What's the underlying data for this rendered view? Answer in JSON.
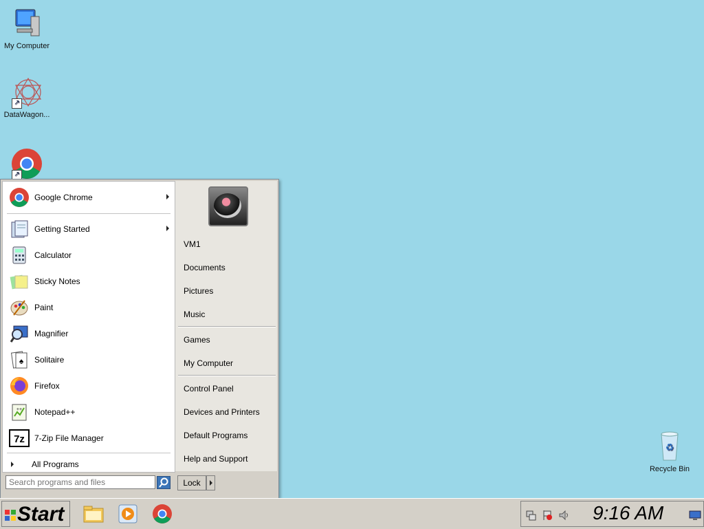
{
  "desktop": {
    "icons": [
      {
        "label": "My Computer"
      },
      {
        "label": "DataWagon..."
      },
      {
        "label": ""
      },
      {
        "label": "Recycle Bin"
      }
    ]
  },
  "start_menu": {
    "pinned": [
      {
        "label": "Google Chrome"
      }
    ],
    "programs": [
      {
        "label": "Getting Started"
      },
      {
        "label": "Calculator"
      },
      {
        "label": "Sticky Notes"
      },
      {
        "label": "Paint"
      },
      {
        "label": "Magnifier"
      },
      {
        "label": "Solitaire"
      },
      {
        "label": "Firefox"
      },
      {
        "label": "Notepad++"
      },
      {
        "label": "7-Zip File Manager"
      }
    ],
    "all_programs": "All Programs",
    "search_placeholder": "Search programs and files",
    "right_links": [
      "VM1",
      "Documents",
      "Pictures",
      "Music",
      "Games",
      "My Computer",
      "Control Panel",
      "Devices and Printers",
      "Default Programs",
      "Help and Support"
    ],
    "lock_label": "Lock"
  },
  "taskbar": {
    "start_label": "Start",
    "clock": "9:16 AM"
  },
  "colors": {
    "desktop": "#9ad7e8",
    "menu": "#d4d0c8"
  }
}
